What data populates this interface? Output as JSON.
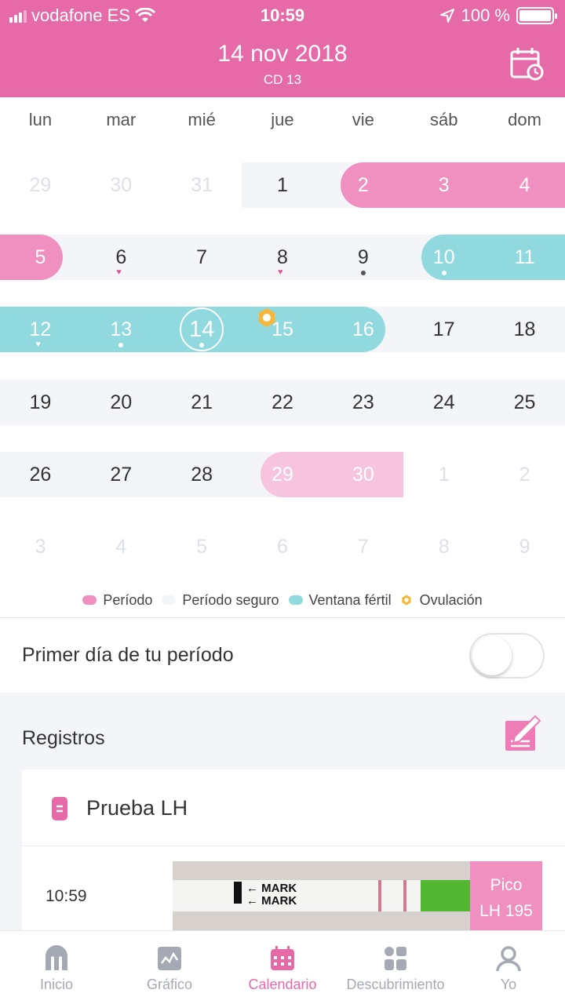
{
  "status_bar": {
    "carrier": "vodafone ES",
    "time": "10:59",
    "battery": "100 %"
  },
  "header": {
    "date": "14 nov 2018",
    "cycle_day": "CD 13",
    "calendar_icon": "calendar-clock-icon"
  },
  "weekdays": [
    "lun",
    "mar",
    "mié",
    "jue",
    "vie",
    "sáb",
    "dom"
  ],
  "calendar": {
    "weeks": [
      [
        {
          "label": "29",
          "state": "other-month"
        },
        {
          "label": "30",
          "state": "other-month"
        },
        {
          "label": "31",
          "state": "other-month"
        },
        {
          "label": "1",
          "state": "safe"
        },
        {
          "label": "2",
          "state": "period"
        },
        {
          "label": "3",
          "state": "period"
        },
        {
          "label": "4",
          "state": "period"
        }
      ],
      [
        {
          "label": "5",
          "state": "period"
        },
        {
          "label": "6",
          "state": "safe",
          "marker": "heart"
        },
        {
          "label": "7",
          "state": "safe"
        },
        {
          "label": "8",
          "state": "safe",
          "marker": "heart"
        },
        {
          "label": "9",
          "state": "safe",
          "marker": "dot"
        },
        {
          "label": "10",
          "state": "fertile",
          "marker": "dot"
        },
        {
          "label": "11",
          "state": "fertile"
        }
      ],
      [
        {
          "label": "12",
          "state": "fertile",
          "marker": "heart"
        },
        {
          "label": "13",
          "state": "fertile",
          "marker": "dot"
        },
        {
          "label": "14",
          "state": "fertile",
          "marker": "dot",
          "today": true
        },
        {
          "label": "15",
          "state": "fertile",
          "ovulation": true
        },
        {
          "label": "16",
          "state": "fertile"
        },
        {
          "label": "17",
          "state": "safe"
        },
        {
          "label": "18",
          "state": "safe"
        }
      ],
      [
        {
          "label": "19",
          "state": "safe"
        },
        {
          "label": "20",
          "state": "safe"
        },
        {
          "label": "21",
          "state": "safe"
        },
        {
          "label": "22",
          "state": "safe"
        },
        {
          "label": "23",
          "state": "safe"
        },
        {
          "label": "24",
          "state": "safe"
        },
        {
          "label": "25",
          "state": "safe"
        }
      ],
      [
        {
          "label": "26",
          "state": "safe"
        },
        {
          "label": "27",
          "state": "safe"
        },
        {
          "label": "28",
          "state": "safe"
        },
        {
          "label": "29",
          "state": "predicted-period"
        },
        {
          "label": "30",
          "state": "predicted-period"
        },
        {
          "label": "1",
          "state": "other-month"
        },
        {
          "label": "2",
          "state": "other-month"
        }
      ],
      [
        {
          "label": "3",
          "state": "other-month"
        },
        {
          "label": "4",
          "state": "other-month"
        },
        {
          "label": "5",
          "state": "other-month"
        },
        {
          "label": "6",
          "state": "other-month"
        },
        {
          "label": "7",
          "state": "other-month"
        },
        {
          "label": "8",
          "state": "other-month"
        },
        {
          "label": "9",
          "state": "other-month"
        }
      ]
    ]
  },
  "legend": {
    "period": "Período",
    "safe": "Período seguro",
    "fertile": "Ventana fértil",
    "ovulation": "Ovulación"
  },
  "first_day": {
    "label": "Primer día de tu período",
    "toggle_on": false
  },
  "records": {
    "title": "Registros",
    "edit_icon": "edit-note-icon",
    "card": {
      "title": "Prueba LH",
      "icon": "lh-test-icon",
      "entry_time": "10:59",
      "strip_text": "MARK",
      "peak_label": "Pico",
      "peak_value": "LH 195"
    }
  },
  "tabs": [
    {
      "label": "Inicio",
      "icon": "home-icon",
      "active": false
    },
    {
      "label": "Gráfico",
      "icon": "chart-icon",
      "active": false
    },
    {
      "label": "Calendario",
      "icon": "calendar-icon",
      "active": true
    },
    {
      "label": "Descubrimiento",
      "icon": "discover-icon",
      "active": false
    },
    {
      "label": "Yo",
      "icon": "user-icon",
      "active": false
    }
  ],
  "colors": {
    "brand_pink": "#e66aa8",
    "period": "#ef90c0",
    "predicted_period": "#f7c4de",
    "fertile": "#8fd9df",
    "safe": "#f4f5f9",
    "ovulation": "#f5b83d"
  }
}
